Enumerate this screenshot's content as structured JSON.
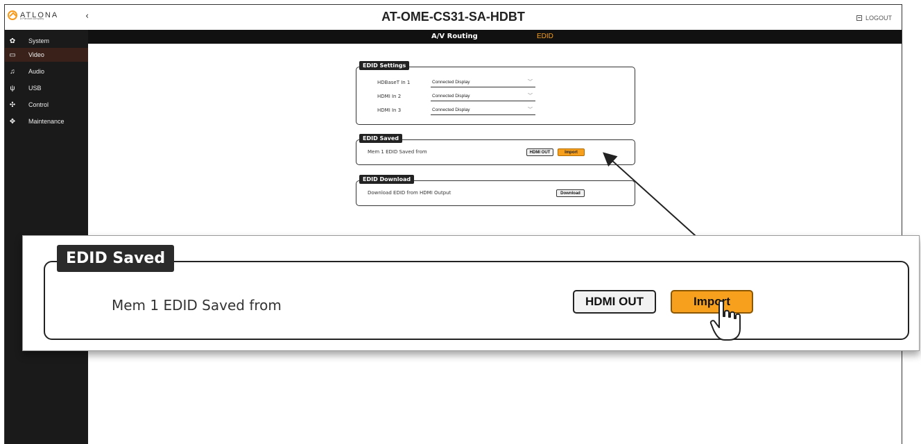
{
  "header": {
    "logo_text": "ATLONA",
    "logo_sub": "a Panduit company",
    "collapse_icon": "chevron-left-icon",
    "title": "AT-OME-CS31-SA-HDBT",
    "logout_label": "LOGOUT"
  },
  "tabs": [
    {
      "label": "A/V Routing"
    },
    {
      "label": "EDID",
      "active": true
    }
  ],
  "sidebar": {
    "items": [
      {
        "label": "System",
        "icon": "gear-icon"
      },
      {
        "label": "Video",
        "icon": "monitor-icon",
        "active": true
      },
      {
        "label": "Audio",
        "icon": "audio-icon"
      },
      {
        "label": "USB",
        "icon": "usb-icon"
      },
      {
        "label": "Control",
        "icon": "network-icon"
      },
      {
        "label": "Maintenance",
        "icon": "move-icon"
      }
    ]
  },
  "edid_settings": {
    "legend": "EDID Settings",
    "rows": [
      {
        "label": "HDBaseT In 1",
        "value": "Connected Display"
      },
      {
        "label": "HDMI In 2",
        "value": "Connected Display"
      },
      {
        "label": "HDMI In 3",
        "value": "Connected Display"
      }
    ]
  },
  "edid_saved": {
    "legend": "EDID Saved",
    "label": "Mem 1 EDID Saved from",
    "source_button": "HDMI OUT",
    "import_button": "Import"
  },
  "edid_download": {
    "legend": "EDID Download",
    "label": "Download EDID from HDMI Output",
    "download_button": "Download"
  },
  "zoom_callout": {
    "legend": "EDID Saved",
    "label": "Mem 1 EDID Saved from",
    "source_button": "HDMI OUT",
    "import_button": "Import"
  },
  "colors": {
    "accent": "#f7a01e",
    "sidebar_bg": "#1a1a1a",
    "active_item_bg": "#3a221a",
    "tabs_bg": "#111111"
  }
}
